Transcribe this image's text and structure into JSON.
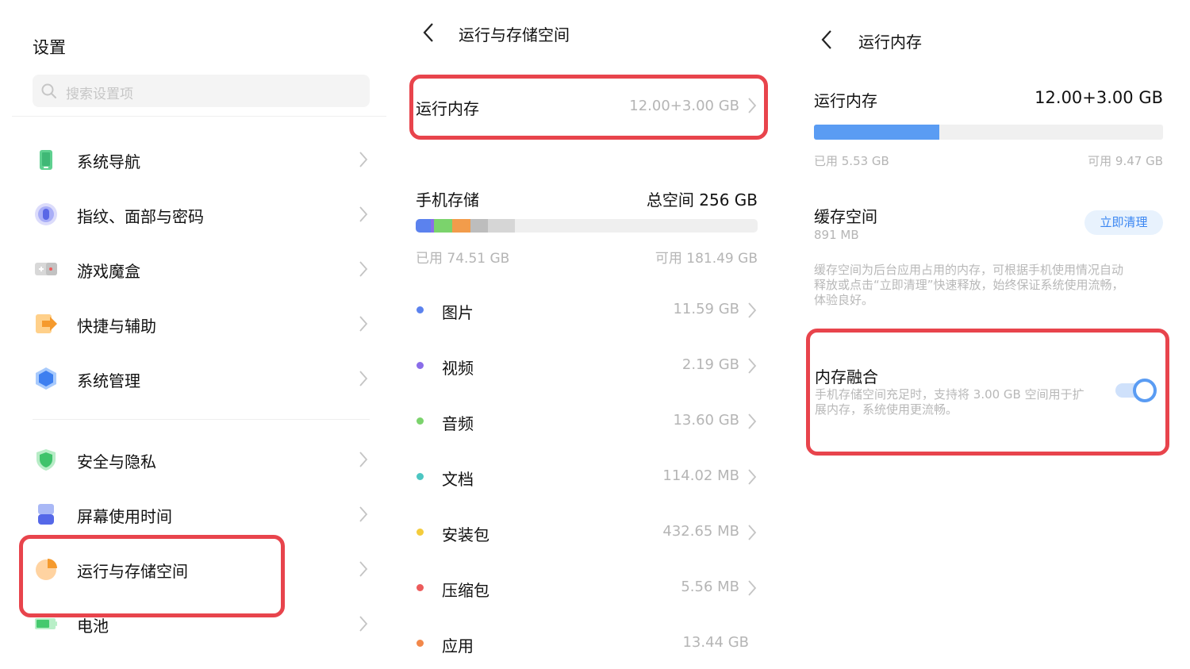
{
  "colors": {
    "accent": "#5a9cf3",
    "highlight": "#e8444c"
  },
  "settings": {
    "title": "设置",
    "search_placeholder": "搜索设置项",
    "items": [
      {
        "label": "系统导航",
        "icon": "phone-icon"
      },
      {
        "label": "指纹、面部与密码",
        "icon": "fingerprint-icon"
      },
      {
        "label": "游戏魔盒",
        "icon": "gamepad-icon"
      },
      {
        "label": "快捷与辅助",
        "icon": "shortcut-icon"
      },
      {
        "label": "系统管理",
        "icon": "hexagon-icon"
      },
      {
        "label": "安全与隐私",
        "icon": "shield-icon"
      },
      {
        "label": "屏幕使用时间",
        "icon": "hourglass-icon"
      },
      {
        "label": "运行与存储空间",
        "icon": "pie-chart-icon"
      },
      {
        "label": "电池",
        "icon": "battery-icon"
      }
    ]
  },
  "storage": {
    "title": "运行与存储空间",
    "ram_label": "运行内存",
    "ram_value": "12.00+3.00 GB",
    "phone_storage_label": "手机存储",
    "total_label": "总空间 256 GB",
    "used_label": "已用 74.51 GB",
    "free_label": "可用 181.49 GB",
    "bar_segments": [
      {
        "color": "#5b82ee",
        "fraction": 0.045
      },
      {
        "color": "#8a6de9",
        "fraction": 0.009
      },
      {
        "color": "#7bd36c",
        "fraction": 0.053
      },
      {
        "color": "#f29c4b",
        "fraction": 0.052
      },
      {
        "color": "#bdbdbd",
        "fraction": 0.052
      },
      {
        "color": "#d6d6d6",
        "fraction": 0.08
      }
    ],
    "categories": [
      {
        "name": "图片",
        "size": "11.59 GB",
        "color": "#5b82ee"
      },
      {
        "name": "视频",
        "size": "2.19 GB",
        "color": "#8a6de9"
      },
      {
        "name": "音频",
        "size": "13.60 GB",
        "color": "#7bd36c"
      },
      {
        "name": "文档",
        "size": "114.02 MB",
        "color": "#4cc6c2"
      },
      {
        "name": "安装包",
        "size": "432.65 MB",
        "color": "#f4cc3c"
      },
      {
        "name": "压缩包",
        "size": "5.56 MB",
        "color": "#ec5b5b"
      },
      {
        "name": "应用",
        "size": "13.44 GB",
        "color": "#f2884a"
      }
    ]
  },
  "ram": {
    "title": "运行内存",
    "label": "运行内存",
    "value": "12.00+3.00 GB",
    "used_fraction": 0.36,
    "used_label": "已用 5.53 GB",
    "free_label": "可用 9.47 GB",
    "cache_label": "缓存空间",
    "cache_value": "891 MB",
    "clean_button": "立即清理",
    "cache_desc_lines": [
      "缓存空间为后台应用占用的内存，可根据手机使用情况自动",
      "释放或点击“立即清理”快速释放，始终保证系统使用流畅，",
      "体验良好。"
    ],
    "fusion_label": "内存融合",
    "fusion_desc_lines": [
      "手机存储空间充足时，支持将 3.00 GB 空间用于扩",
      "展内存，系统使用更流畅。"
    ],
    "fusion_enabled": true
  }
}
